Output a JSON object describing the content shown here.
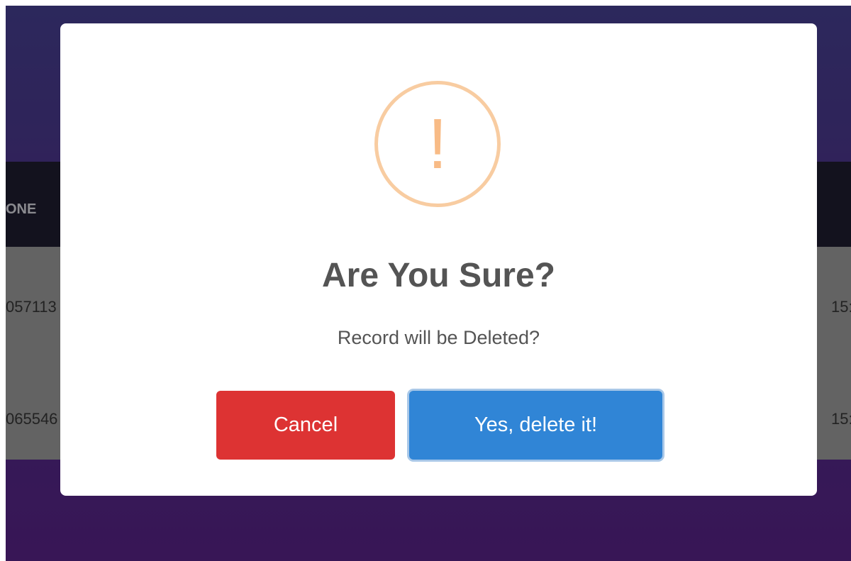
{
  "background_table": {
    "header_col": "ONE",
    "rows": [
      {
        "left": "057113",
        "right": "15:"
      },
      {
        "left": "065546",
        "right": "15:"
      }
    ]
  },
  "dialog": {
    "icon": "exclamation-icon",
    "icon_glyph": "!",
    "title": "Are You Sure?",
    "message": "Record will be Deleted?",
    "cancel_label": "Cancel",
    "confirm_label": "Yes, delete it!"
  },
  "colors": {
    "cancel": "#dd3333",
    "confirm": "#3085d6",
    "warning": "#f8bb86"
  }
}
